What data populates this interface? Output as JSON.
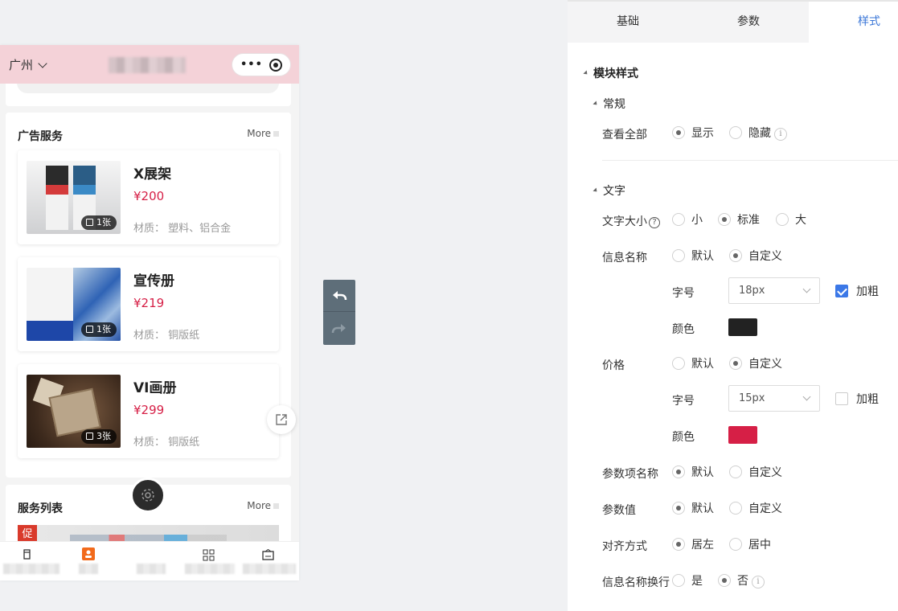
{
  "preview": {
    "city": "广州",
    "more_label": "More",
    "ad_section_title": "广告服务",
    "products": [
      {
        "name": "X展架",
        "price": "¥200",
        "material": "材质：  塑料、铝合金",
        "count": "1张"
      },
      {
        "name": "宣传册",
        "price": "¥219",
        "material": "材质：  铜版纸",
        "count": "1张"
      },
      {
        "name": "VI画册",
        "price": "¥299",
        "material": "材质：  铜版纸",
        "count": "3张"
      }
    ],
    "service_section_title": "服务列表",
    "promo_tag": "促"
  },
  "panel": {
    "tabs": [
      "基础",
      "参数",
      "样式"
    ],
    "active_tab": "样式",
    "module_style": "模块样式",
    "general": "常规",
    "view_all": {
      "label": "查看全部",
      "options": [
        "显示",
        "隐藏"
      ],
      "selected": "显示"
    },
    "text_section": "文字",
    "text_size": {
      "label": "文字大小",
      "options": [
        "小",
        "标准",
        "大"
      ],
      "selected": "标准"
    },
    "info_name": {
      "label": "信息名称",
      "options": [
        "默认",
        "自定义"
      ],
      "selected": "自定义",
      "size_label": "字号",
      "size": "18px",
      "bold_label": "加粗",
      "bold": true,
      "color_label": "颜色",
      "color": "#222222"
    },
    "price": {
      "label": "价格",
      "options": [
        "默认",
        "自定义"
      ],
      "selected": "自定义",
      "size_label": "字号",
      "size": "15px",
      "bold_label": "加粗",
      "bold": false,
      "color_label": "颜色",
      "color": "#d61f46"
    },
    "param_name": {
      "label": "参数项名称",
      "options": [
        "默认",
        "自定义"
      ],
      "selected": "默认"
    },
    "param_value": {
      "label": "参数值",
      "options": [
        "默认",
        "自定义"
      ],
      "selected": "默认"
    },
    "align": {
      "label": "对齐方式",
      "options": [
        "居左",
        "居中"
      ],
      "selected": "居左"
    },
    "name_wrap": {
      "label": "信息名称换行",
      "options": [
        "是",
        "否"
      ],
      "selected": "否"
    }
  },
  "colors": {
    "accent": "#3875d7",
    "price_red": "#d61f46",
    "header_pink": "#f4d2d8"
  }
}
